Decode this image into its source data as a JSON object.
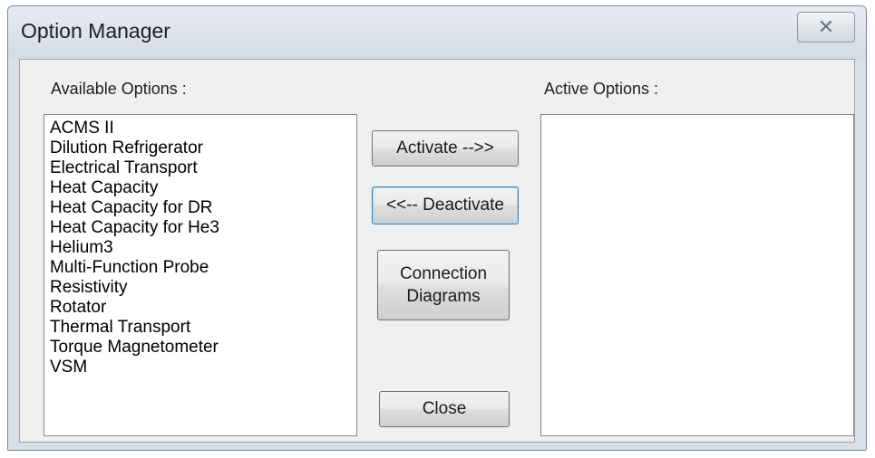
{
  "window": {
    "title": "Option Manager",
    "close_glyph": "✕"
  },
  "available": {
    "label": "Available Options :",
    "items": [
      "ACMS II",
      "Dilution Refrigerator",
      "Electrical Transport",
      "Heat Capacity",
      "Heat Capacity for DR",
      "Heat Capacity for He3",
      "Helium3",
      "Multi-Function Probe",
      "Resistivity",
      "Rotator",
      "Thermal Transport",
      "Torque Magnetometer",
      "VSM"
    ]
  },
  "active": {
    "label": "Active Options :",
    "items": []
  },
  "buttons": {
    "activate": "Activate -->>",
    "deactivate": "<<-- Deactivate",
    "connection_line1": "Connection",
    "connection_line2": "Diagrams",
    "close": "Close"
  }
}
